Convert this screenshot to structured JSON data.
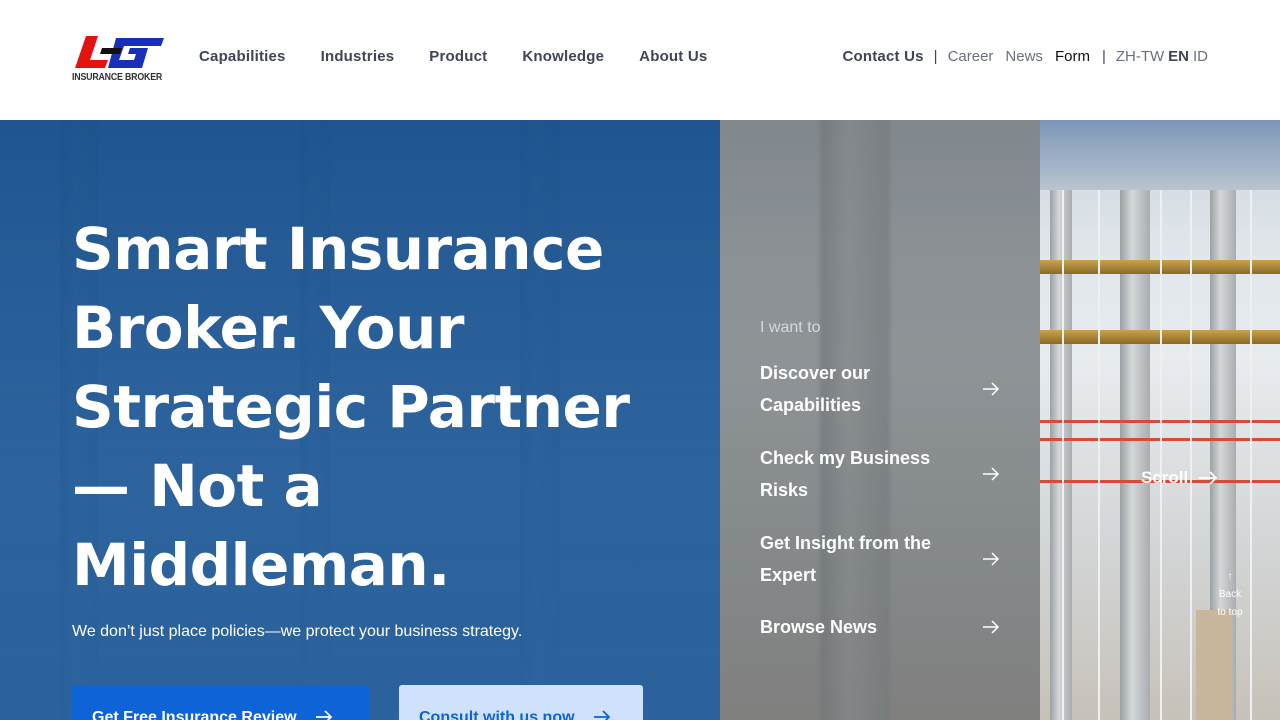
{
  "brand": {
    "logo_text": "INSURANCE BROKER",
    "colors": {
      "red": "#e3130f",
      "blue": "#1a2fb8"
    }
  },
  "nav": {
    "items": [
      "Capabilities",
      "Industries",
      "Product",
      "Knowledge",
      "About Us"
    ]
  },
  "utility": {
    "contact": "Contact Us",
    "sep": "|",
    "links": [
      "Career",
      "News",
      "Form"
    ],
    "languages": [
      "ZH-TW",
      "EN",
      "ID"
    ],
    "active_language": "EN"
  },
  "hero": {
    "headline": "Smart Insurance Broker. Your Strategic Partner — Not a Middleman.",
    "subline": "We don’t just place policies—we protect your business strategy.",
    "primary_cta": "Get Free Insurance Review",
    "secondary_cta": "Consult with us now",
    "blue_overlay": "#155294"
  },
  "want": {
    "label": "I want to",
    "items": [
      "Discover our Capabilities",
      "Check my Business Risks",
      "Get Insight from the Expert",
      "Browse News"
    ]
  },
  "scroll": {
    "label": "Scroll"
  },
  "back_to_top": {
    "line1": "Back",
    "line2": "to top"
  }
}
